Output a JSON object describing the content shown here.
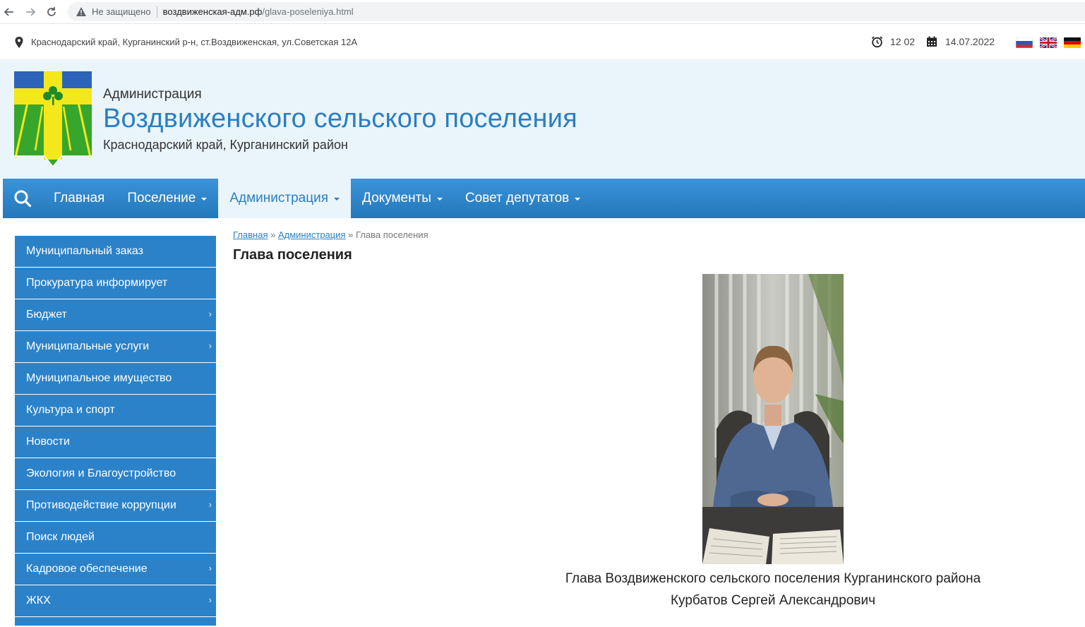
{
  "browser": {
    "security_label": "Не защищено",
    "url_host": "воздвиженская-адм.рф",
    "url_path": "/glava-poseleniya.html"
  },
  "topbar": {
    "address": "Краснодарский край, Курганинский р-н, ст.Воздвиженская, ул.Советская 12А",
    "time": "12 02",
    "date": "14.07.2022",
    "flags": [
      "ru-flag",
      "uk-flag",
      "de-flag"
    ]
  },
  "header": {
    "pre_title": "Администрация",
    "title": "Воздвиженского сельского поселения",
    "region": "Краснодарский край, Курганинский район"
  },
  "nav": {
    "items": [
      {
        "label": "Главная",
        "dropdown": false
      },
      {
        "label": "Поселение",
        "dropdown": true
      },
      {
        "label": "Администрация",
        "dropdown": true,
        "active": true
      },
      {
        "label": "Документы",
        "dropdown": true
      },
      {
        "label": "Совет депутатов",
        "dropdown": true
      }
    ]
  },
  "sidebar": {
    "items": [
      {
        "label": "Муниципальный заказ",
        "submenu": false
      },
      {
        "label": "Прокуратура информирует",
        "submenu": false
      },
      {
        "label": "Бюджет",
        "submenu": true
      },
      {
        "label": "Муниципальные услуги",
        "submenu": true
      },
      {
        "label": "Муниципальное имущество",
        "submenu": false
      },
      {
        "label": "Культура и спорт",
        "submenu": false
      },
      {
        "label": "Новости",
        "submenu": false
      },
      {
        "label": "Экология и Благоустройство",
        "submenu": false
      },
      {
        "label": "Противодействие коррупции",
        "submenu": true
      },
      {
        "label": "Поиск людей",
        "submenu": false
      },
      {
        "label": "Кадровое обеспечение",
        "submenu": true
      },
      {
        "label": "ЖКХ",
        "submenu": true
      }
    ],
    "arrow": "›"
  },
  "content": {
    "breadcrumb": {
      "home": "Главная",
      "section": "Администрация",
      "current": "Глава поселения",
      "separator": "»"
    },
    "title": "Глава поселения",
    "caption_line1": "Глава Воздвиженского сельского поселения Курганинского района",
    "caption_line2": "Курбатов Сергей Александрович"
  },
  "colors": {
    "accent": "#2a7fc0",
    "nav_bg": "#2b82c9",
    "header_bg": "#eaf4fb"
  }
}
